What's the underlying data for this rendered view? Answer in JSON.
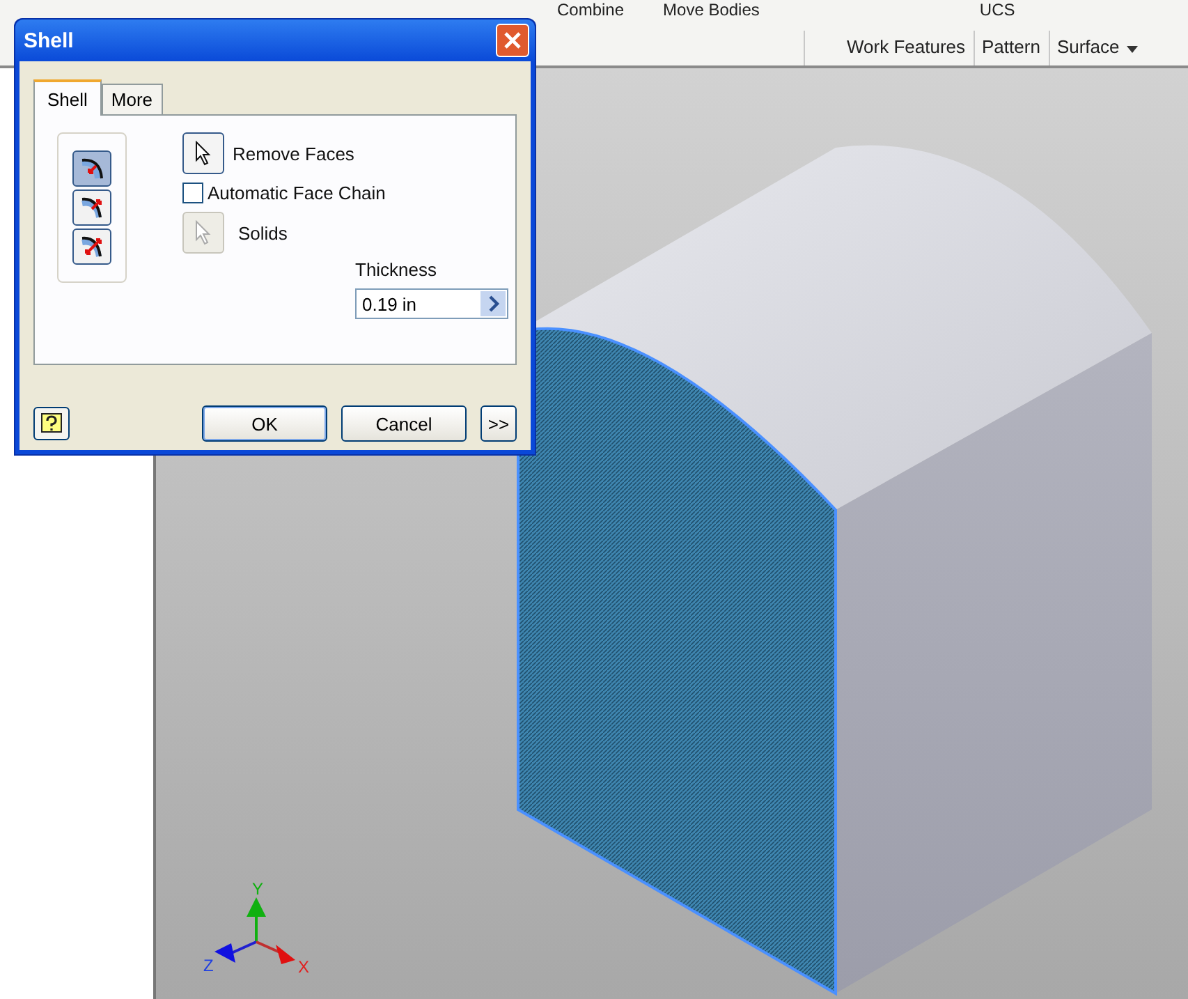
{
  "ribbon": {
    "tools": [
      {
        "label": "Combine"
      },
      {
        "label": "Move Bodies"
      },
      {
        "label": "UCS"
      }
    ],
    "panels": [
      {
        "label": "Work Features",
        "dropdown": false
      },
      {
        "label": "Pattern",
        "dropdown": false
      },
      {
        "label": "Surface",
        "dropdown": true
      }
    ]
  },
  "dialog": {
    "title": "Shell",
    "tabs": [
      {
        "label": "Shell",
        "selected": true
      },
      {
        "label": "More",
        "selected": false
      }
    ],
    "direction_buttons": [
      {
        "kind": "inside",
        "selected": true
      },
      {
        "kind": "outside",
        "selected": false
      },
      {
        "kind": "both",
        "selected": false
      }
    ],
    "remove_faces": {
      "label": "Remove Faces"
    },
    "automatic_face_chain": {
      "label": "Automatic Face Chain",
      "checked": false
    },
    "solids": {
      "label": "Solids",
      "disabled": true
    },
    "thickness": {
      "label": "Thickness",
      "value": "0.19 in"
    },
    "buttons": [
      {
        "label": "OK",
        "default": true
      },
      {
        "label": "Cancel",
        "default": false
      },
      {
        "label": ">>",
        "default": false
      }
    ]
  },
  "viewport": {
    "axes": [
      {
        "label": "X"
      },
      {
        "label": "Y"
      },
      {
        "label": "Z"
      }
    ]
  }
}
